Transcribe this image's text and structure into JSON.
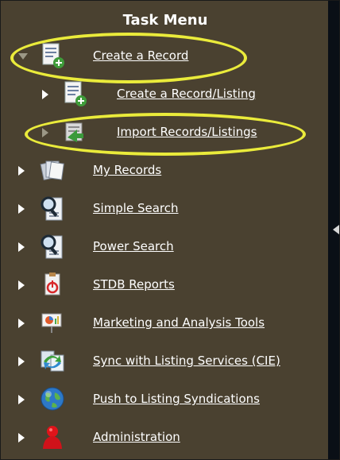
{
  "menu": {
    "title": "Task Menu",
    "items": [
      {
        "label": "Create a Record",
        "icon": "document-add-icon",
        "expanded": true
      },
      {
        "label": "Create a Record/Listing",
        "icon": "document-add-icon"
      },
      {
        "label": "Import Records/Listings",
        "icon": "import-icon"
      },
      {
        "label": "My Records",
        "icon": "records-stack-icon"
      },
      {
        "label": "Simple Search",
        "icon": "magnifier-document-icon"
      },
      {
        "label": "Power Search",
        "icon": "magnifier-document-icon"
      },
      {
        "label": "STDB Reports",
        "icon": "report-icon"
      },
      {
        "label": "Marketing and Analysis Tools",
        "icon": "presentation-icon"
      },
      {
        "label": "Sync with Listing Services (CIE)",
        "icon": "sync-icon"
      },
      {
        "label": "Push to Listing Syndications",
        "icon": "globe-icon"
      },
      {
        "label": "Administration",
        "icon": "administrator-icon"
      }
    ]
  },
  "colors": {
    "panel_background": "#4a4130",
    "highlight": "#eaeb3b",
    "text": "#ffffff"
  }
}
